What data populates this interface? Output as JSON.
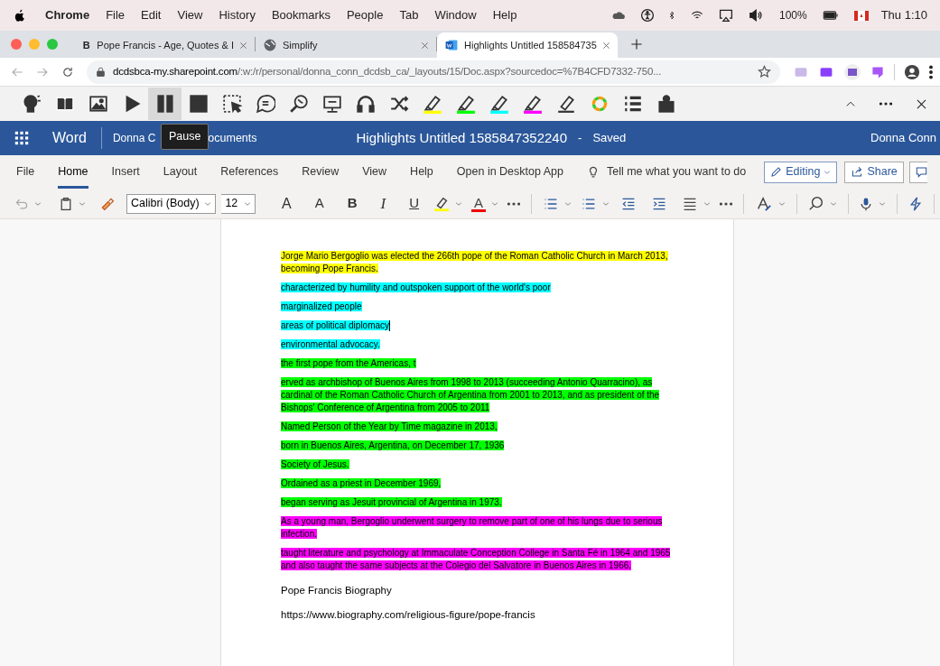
{
  "menu_bar": {
    "app": "Chrome",
    "items": [
      "File",
      "Edit",
      "View",
      "History",
      "Bookmarks",
      "People",
      "Tab",
      "Window",
      "Help"
    ],
    "battery": "100%",
    "clock": "Thu 1:10"
  },
  "browser_tabs": [
    {
      "kind": "letter",
      "favicon_text": "B",
      "title": "Pope Francis - Age, Quotes & I",
      "selected": false
    },
    {
      "kind": "globe",
      "title": "Simplify",
      "selected": false
    },
    {
      "kind": "word",
      "title": "Highlights Untitled 158584735",
      "selected": true
    }
  ],
  "address_bar": {
    "host": "dcdsbca-my.sharepoint.com",
    "path": "/:w:/r/personal/donna_conn_dcdsb_ca/_layouts/15/Doc.aspx?sourcedoc=%7B4CFD7332-750..."
  },
  "extension_toolbar": {
    "tooltip": "Pause",
    "tools": [
      {
        "kind": "talk",
        "selected": false
      },
      {
        "kind": "book",
        "selected": false
      },
      {
        "kind": "picture",
        "selected": false
      },
      {
        "kind": "play",
        "selected": false
      },
      {
        "kind": "pause",
        "selected": true
      },
      {
        "kind": "stop",
        "selected": false
      },
      {
        "kind": "select",
        "selected": false
      },
      {
        "kind": "audio",
        "selected": false
      },
      {
        "kind": "websearch",
        "selected": false
      },
      {
        "kind": "monitor",
        "selected": false
      },
      {
        "kind": "headphones",
        "selected": false
      },
      {
        "kind": "shuffle",
        "selected": false
      },
      {
        "kind": "highlighter",
        "color": "#ffff00",
        "selected": false
      },
      {
        "kind": "highlighter",
        "color": "#00ff00",
        "selected": false
      },
      {
        "kind": "highlighter",
        "color": "#00ffff",
        "selected": false
      },
      {
        "kind": "highlighter",
        "color": "#ff00ff",
        "selected": false
      },
      {
        "kind": "eraser",
        "selected": false
      },
      {
        "kind": "collector",
        "selected": false
      },
      {
        "kind": "list",
        "selected": false
      },
      {
        "kind": "teacher",
        "selected": false
      }
    ]
  },
  "word_header": {
    "app": "Word",
    "breadcrumb_start": "Donna C",
    "breadcrumb_end": "ocuments",
    "title": "Highlights Untitled 1585847352240",
    "separator": "-",
    "status": "Saved",
    "user": "Donna Conn"
  },
  "ribbon_tabs": [
    {
      "label": "File",
      "selected": false
    },
    {
      "label": "Home",
      "selected": true
    },
    {
      "label": "Insert",
      "selected": false
    },
    {
      "label": "Layout",
      "selected": false
    },
    {
      "label": "References",
      "selected": false
    },
    {
      "label": "Review",
      "selected": false
    },
    {
      "label": "View",
      "selected": false
    },
    {
      "label": "Help",
      "selected": false
    },
    {
      "label": "Open in Desktop App",
      "selected": false
    }
  ],
  "tell_me": "Tell me what you want to do",
  "editing_button": "Editing",
  "share_button": "Share",
  "font_name": "Calibri (Body)",
  "font_size": "12",
  "format_buttons": [
    {
      "kind": "grow",
      "label": "A"
    },
    {
      "kind": "shrink",
      "label": "A"
    },
    {
      "kind": "bold",
      "label": "B"
    },
    {
      "kind": "italic",
      "label": "I"
    },
    {
      "kind": "underline",
      "label": "U"
    }
  ],
  "font_color_label": "A",
  "paragraphs": [
    {
      "kind": "highlight",
      "color": "#ffff00",
      "cursor": false,
      "text": "Jorge Mario Bergoglio was elected the 266th pope of the Roman Catholic Church in March 2013, becoming Pope Francis."
    },
    {
      "kind": "highlight",
      "color": "#00ffff",
      "cursor": false,
      "text": "characterized by humility and outspoken support of the world's poor"
    },
    {
      "kind": "highlight",
      "color": "#00ffff",
      "cursor": false,
      "text": "marginalized people"
    },
    {
      "kind": "highlight",
      "color": "#00ffff",
      "cursor": true,
      "text": "areas of political diplomacy"
    },
    {
      "kind": "highlight",
      "color": "#00ffff",
      "cursor": false,
      "text": "environmental advocacy."
    },
    {
      "kind": "highlight",
      "color": "#00ff00",
      "cursor": false,
      "text": "the first pope from the Americas, t"
    },
    {
      "kind": "highlight",
      "color": "#00ff00",
      "cursor": false,
      "text": "erved as archbishop of Buenos Aires from 1998 to 2013 (succeeding Antonio Quarracino), as cardinal of the Roman Catholic Church of Argentina from 2001 to 2013, and as president of the Bishops' Conference of Argentina from 2005 to 2011"
    },
    {
      "kind": "highlight",
      "color": "#00ff00",
      "cursor": false,
      "text": "Named Person of the Year by Time magazine in 2013,"
    },
    {
      "kind": "highlight",
      "color": "#00ff00",
      "cursor": false,
      "text": "born in Buenos Aires, Argentina, on December 17, 1936"
    },
    {
      "kind": "highlight",
      "color": "#00ff00",
      "cursor": false,
      "text": "Society of Jesus."
    },
    {
      "kind": "highlight",
      "color": "#00ff00",
      "cursor": false,
      "text": "Ordained as a priest in December 1969,"
    },
    {
      "kind": "highlight",
      "color": "#00ff00",
      "cursor": false,
      "text": "began serving as Jesuit provincial of Argentina in 1973."
    },
    {
      "kind": "highlight",
      "color": "#ff00ff",
      "cursor": false,
      "text": "As a young man, Bergoglio underwent surgery to remove part of one of his lungs due to serious infection."
    },
    {
      "kind": "highlight",
      "color": "#ff00ff",
      "cursor": false,
      "text": "taught literature and psychology at Immaculate Conception College in Santa Fé in 1964 and 1965 and also taught the same subjects at the Colegio del Salvatore in Buenos Aires in 1966."
    },
    {
      "kind": "plain",
      "cursor": false,
      "text": "Pope Francis Biography"
    },
    {
      "kind": "plain",
      "cursor": false,
      "text": "https://www.biography.com/religious-figure/pope-francis"
    }
  ]
}
